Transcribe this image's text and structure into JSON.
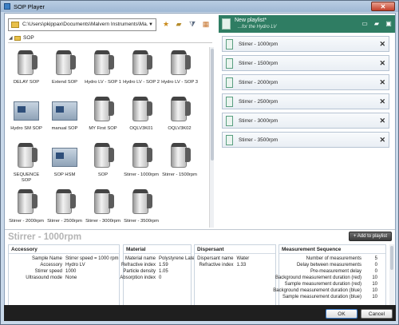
{
  "window": {
    "title": "SOP Player",
    "close_label": "✕"
  },
  "toolbar": {
    "path": "C:\\Users\\pkippax\\Documents\\Malvern Instruments\\Ma...",
    "icons": [
      "star-icon",
      "new-folder-icon",
      "filter-icon",
      "view-icon"
    ]
  },
  "folder": {
    "label": "SOP"
  },
  "tiles": [
    {
      "label": "DELAY SOP",
      "type": "cylinder"
    },
    {
      "label": "Extend SOP",
      "type": "cylinder"
    },
    {
      "label": "Hydro LV - SOP 1",
      "type": "cylinder"
    },
    {
      "label": "Hydro LV - SOP 2",
      "type": "cylinder"
    },
    {
      "label": "Hydro LV - SOP 3",
      "type": "cylinder"
    },
    {
      "label": "Hydro SM SOP",
      "type": "box"
    },
    {
      "label": "manual SOP",
      "type": "box"
    },
    {
      "label": "MY First SOP",
      "type": "cylinder"
    },
    {
      "label": "OQLV3K01",
      "type": "cylinder"
    },
    {
      "label": "OQLV3K02",
      "type": "cylinder"
    },
    {
      "label": "SEQUENCE SOP",
      "type": "cylinder"
    },
    {
      "label": "SOP HSM",
      "type": "box"
    },
    {
      "label": "SOP",
      "type": "cylinder"
    },
    {
      "label": "Stirrer - 1000rpm",
      "type": "cylinder"
    },
    {
      "label": "Stirrer - 1500rpm",
      "type": "cylinder"
    },
    {
      "label": "Stirrer - 2000rpm",
      "type": "cylinder"
    },
    {
      "label": "Stirrer - 2500rpm",
      "type": "cylinder"
    },
    {
      "label": "Stirrer - 3000rpm",
      "type": "cylinder"
    },
    {
      "label": "Stirrer - 3500rpm",
      "type": "cylinder"
    }
  ],
  "playlist": {
    "title": "New playlist*",
    "subtitle": "...for the Hydro LV",
    "items": [
      "Stirrer - 1000rpm",
      "Stirrer - 1500rpm",
      "Stirrer - 2000rpm",
      "Stirrer - 2500rpm",
      "Stirrer - 3000rpm",
      "Stirrer - 3500rpm"
    ],
    "remove_label": "✕"
  },
  "details": {
    "title": "Stirrer - 1000rpm",
    "add_label": "+ Add to playlist",
    "accessory": {
      "heading": "Accessory",
      "rows": [
        {
          "k": "Sample Name",
          "v": "Stirrer speed = 1000 rpm"
        },
        {
          "k": "Accessory",
          "v": "Hydro LV"
        },
        {
          "k": "Stirrer speed",
          "v": "1000"
        },
        {
          "k": "Ultrasound mode",
          "v": "None"
        }
      ]
    },
    "material": {
      "heading": "Material",
      "rows": [
        {
          "k": "Material name",
          "v": "Polystyrene Latex"
        },
        {
          "k": "Refractive index",
          "v": "1.59"
        },
        {
          "k": "Particle density",
          "v": "1.05"
        },
        {
          "k": "Absorption index",
          "v": "0"
        }
      ]
    },
    "dispersant": {
      "heading": "Dispersant",
      "rows": [
        {
          "k": "Dispersant name",
          "v": "Water"
        },
        {
          "k": "Refractive index",
          "v": "1.33"
        }
      ]
    },
    "sequence": {
      "heading": "Measurement Sequence",
      "rows": [
        {
          "k": "Number of measurements",
          "v": "5"
        },
        {
          "k": "Delay between measurements",
          "v": "0"
        },
        {
          "k": "Pre-measurement delay",
          "v": "0"
        },
        {
          "k": "Background measurement duration (red)",
          "v": "10"
        },
        {
          "k": "Sample measurement duration (red)",
          "v": "10"
        },
        {
          "k": "Background measurement duration (blue)",
          "v": "10"
        },
        {
          "k": "Sample measurement duration (blue)",
          "v": "10"
        }
      ]
    }
  },
  "footer": {
    "ok_label": "OK",
    "cancel_label": "Cancel"
  }
}
